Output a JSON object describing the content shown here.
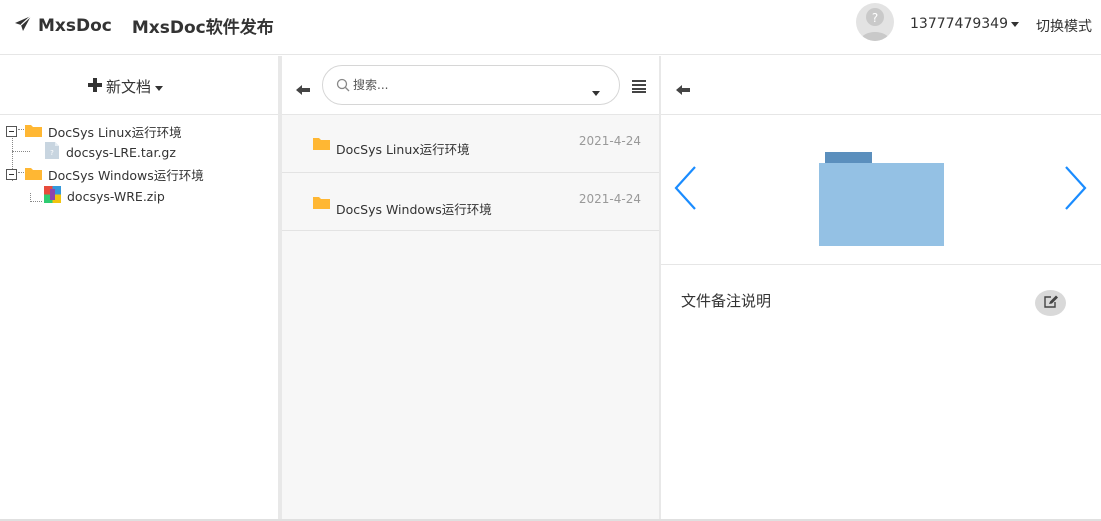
{
  "header": {
    "brand_name": "MxsDoc",
    "title": "MxsDoc软件发布",
    "user": "13777479349",
    "switch_mode": "切换模式"
  },
  "left_panel": {
    "new_doc_label": "新文档",
    "tree": [
      {
        "label": "DocSys Linux运行环境",
        "type": "folder",
        "children": [
          {
            "label": "docsys-LRE.tar.gz",
            "type": "file-generic"
          }
        ]
      },
      {
        "label": "DocSys Windows运行环境",
        "type": "folder",
        "children": [
          {
            "label": "docsys-WRE.zip",
            "type": "file-zip"
          }
        ]
      }
    ]
  },
  "middle_panel": {
    "search_placeholder": "搜索...",
    "items": [
      {
        "name": "DocSys Linux运行环境",
        "date": "2021-4-24"
      },
      {
        "name": "DocSys Windows运行环境",
        "date": "2021-4-24"
      }
    ]
  },
  "right_panel": {
    "remarks_label": "文件备注说明"
  },
  "colors": {
    "folder": "#ffb733",
    "preview_folder": "#94c1e4",
    "preview_tab": "#5b8fbd",
    "nav_arrow": "#1a8cff"
  }
}
